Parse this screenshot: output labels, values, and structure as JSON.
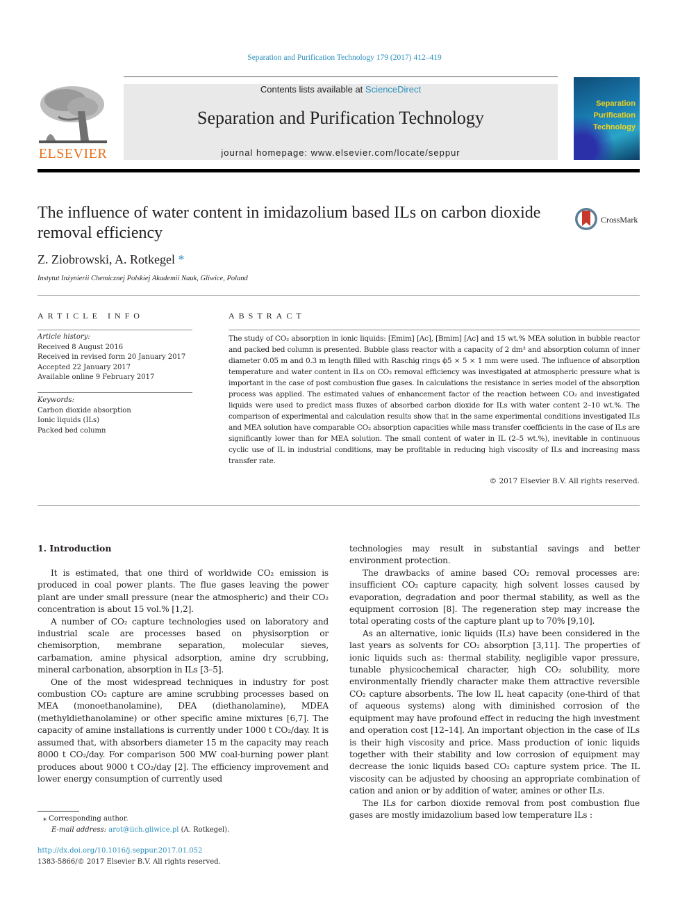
{
  "header": {
    "journal_reference": "Separation and Purification Technology 179 (2017) 412–419",
    "contents_prefix": "Contents lists available at ",
    "contents_link": "ScienceDirect",
    "journal_title": "Separation and Purification Technology",
    "homepage": "journal homepage: www.elsevier.com/locate/seppur",
    "publisher_logo_text": "ELSEVIER",
    "cover_title_lines": [
      "Separation",
      "Purification",
      "Technology"
    ]
  },
  "article": {
    "title": "The influence of water content in imidazolium based ILs on carbon dioxide removal efficiency",
    "crossmark_label": "CrossMark",
    "authors": "Z. Ziobrowski, A. Rotkegel",
    "corresponding_mark": "*",
    "affiliation": "Instytut Inżynierii Chemicznej Polskiej Akademii Nauk, Gliwice, Poland"
  },
  "article_info": {
    "heading": "ARTICLE INFO",
    "history_label": "Article history:",
    "history": [
      "Received 8 August 2016",
      "Received in revised form 20 January 2017",
      "Accepted 22 January 2017",
      "Available online 9 February 2017"
    ],
    "keywords_label": "Keywords:",
    "keywords": [
      "Carbon dioxide absorption",
      "Ionic liquids (ILs)",
      "Packed bed column"
    ]
  },
  "abstract": {
    "heading": "ABSTRACT",
    "text": "The study of CO₂ absorption in ionic liquids: [Emim] [Ac], [Bmim] [Ac] and 15 wt.% MEA solution in bubble reactor and packed bed column is presented. Bubble glass reactor with a capacity of 2 dm³ and absorption column of inner diameter 0.05 m and 0.3 m length filled with Raschig rings ϕ5 × 5 × 1 mm were used. The influence of absorption temperature and water content in ILs on CO₂ removal efficiency was investigated at atmospheric pressure what is important in the case of post combustion flue gases. In calculations the resistance in series model of the absorption process was applied. The estimated values of enhancement factor of the reaction between CO₂ and investigated liquids were used to predict mass fluxes of absorbed carbon dioxide for ILs with water content 2–10 wt.%. The comparison of experimental and calculation results show that in the same experimental conditions investigated ILs and MEA solution have comparable CO₂ absorption capacities while mass transfer coefficients in the case of ILs are significantly lower than for MEA solution. The small content of water in IL (2–5 wt.%), inevitable in continuous cyclic use of IL in industrial conditions, may be profitable in reducing high viscosity of ILs and increasing mass transfer rate.",
    "copyright": "© 2017 Elsevier B.V. All rights reserved."
  },
  "body": {
    "section_heading": "1. Introduction",
    "left_paragraphs": [
      "It is estimated, that one third of worldwide CO₂ emission is produced in coal power plants. The flue gases leaving the power plant are under small pressure (near the atmospheric) and their CO₂ concentration is about 15 vol.% [1,2].",
      "A number of CO₂ capture technologies used on laboratory and industrial scale are processes based on physisorption or chemisorption, membrane separation, molecular sieves, carbamation, amine physical adsorption, amine dry scrubbing, mineral carbonation, absorption in ILs [3–5].",
      "One of the most widespread techniques in industry for post combustion CO₂ capture are amine scrubbing processes based on MEA (monoethanolamine), DEA (diethanolamine), MDEA (methyldiethanolamine) or other specific amine mixtures [6,7]. The capacity of amine installations is currently under 1000 t CO₂/day. It is assumed that, with absorbers diameter 15 m the capacity may reach 8000 t CO₂/day. For comparison 500 MW coal-burning power plant produces about 9000 t CO₂/day [2]. The efficiency improvement and lower energy consumption of currently used"
    ],
    "right_continuation": "technologies may result in substantial savings and better environment protection.",
    "right_paragraphs": [
      "The drawbacks of amine based CO₂ removal processes are: insufficient CO₂ capture capacity, high solvent losses caused by evaporation, degradation and poor thermal stability, as well as the equipment corrosion [8]. The regeneration step may increase the total operating costs of the capture plant up to 70% [9,10].",
      "As an alternative, ionic liquids (ILs) have been considered in the last years as solvents for CO₂ absorption [3,11]. The properties of ionic liquids such as: thermal stability, negligible vapor pressure, tunable physicochemical character, high CO₂ solubility, more environmentally friendly character make them attractive reversible CO₂ capture absorbents. The low IL heat capacity (one-third of that of aqueous systems) along with diminished corrosion of the equipment may have profound effect in reducing the high investment and operation cost [12–14]. An important objection in the case of ILs is their high viscosity and price. Mass production of ionic liquids together with their stability and low corrosion of equipment may decrease the ionic liquids based CO₂ capture system price. The IL viscosity can be adjusted by choosing an appropriate combination of cation and anion or by addition of water, amines or other ILs.",
      "The ILs for carbon dioxide removal from post combustion flue gases are mostly imidazolium based low temperature ILs :"
    ]
  },
  "footer": {
    "corresponding_note": "⁎ Corresponding author.",
    "email_label": "E-mail address: ",
    "email": "arot@iich.gliwice.pl",
    "email_suffix": " (A. Rotkegel).",
    "doi": "http://dx.doi.org/10.1016/j.seppur.2017.01.052",
    "issn_line": "1383-5866/© 2017 Elsevier B.V. All rights reserved."
  },
  "colors": {
    "link": "#2a8fbd",
    "elsevier_orange": "#e9711c",
    "banner_gray": "#e9e9e9"
  }
}
